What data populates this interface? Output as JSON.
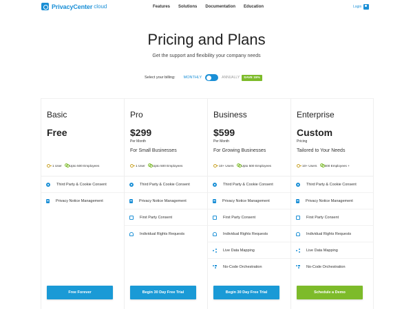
{
  "header": {
    "logo_text": "PrivacyCenter",
    "logo_sub": "cloud",
    "nav": [
      "Features",
      "Solutions",
      "Documentation",
      "Education"
    ],
    "login": "Login"
  },
  "hero": {
    "title": "Pricing and Plans",
    "subtitle": "Get the support and flexibility your company needs"
  },
  "billing": {
    "label": "Select your billing:",
    "monthly": "MONTHLY",
    "annually": "ANNUALLY",
    "save_badge": "SAVE 15%"
  },
  "colors": {
    "brand_blue": "#1a8fd6",
    "cta_blue": "#1a9ad6",
    "accent_green": "#7dbb2a"
  },
  "plans": [
    {
      "name": "Basic",
      "price": "Free",
      "period": "",
      "tagline": "",
      "users": "1 User",
      "employees": "Upto 500 Employees",
      "features": [
        {
          "icon": "cookie-icon",
          "label": "Third Party & Cookie Consent"
        },
        {
          "icon": "notice-icon",
          "label": "Privacy Notice Management"
        }
      ],
      "cta": "Free Forever"
    },
    {
      "name": "Pro",
      "price": "$299",
      "period": "Per Month",
      "tagline": "For Small Businesses",
      "users": "1 User",
      "employees": "Upto 500 Employees",
      "features": [
        {
          "icon": "cookie-icon",
          "label": "Third Party & Cookie Consent"
        },
        {
          "icon": "notice-icon",
          "label": "Privacy Notice Management"
        },
        {
          "icon": "first-party-icon",
          "label": "First Party Consent"
        },
        {
          "icon": "rights-icon",
          "label": "Individual Rights Requests"
        }
      ],
      "cta": "Begin 30 Day Free Trial"
    },
    {
      "name": "Business",
      "price": "$599",
      "period": "Per Month",
      "tagline": "For Growing Businesses",
      "users": "10+ Users",
      "employees": "Upto 500 Employees",
      "features": [
        {
          "icon": "cookie-icon",
          "label": "Third Party & Cookie Consent"
        },
        {
          "icon": "notice-icon",
          "label": "Privacy Notice Management"
        },
        {
          "icon": "first-party-icon",
          "label": "First Party Consent"
        },
        {
          "icon": "rights-icon",
          "label": "Individual Rights Requests"
        },
        {
          "icon": "mapping-icon",
          "label": "Live Data Mapping"
        },
        {
          "icon": "orchestration-icon",
          "label": "No-Code Orchestration"
        }
      ],
      "cta": "Begin 30 Day Free Trial"
    },
    {
      "name": "Enterprise",
      "price": "Custom",
      "period": "Pricing",
      "tagline": "Tailored to Your Needs",
      "users": "10+ Users",
      "employees": "600 Employees +",
      "features": [
        {
          "icon": "cookie-icon",
          "label": "Third Party & Cookie Consent"
        },
        {
          "icon": "notice-icon",
          "label": "Privacy Notice Management"
        },
        {
          "icon": "first-party-icon",
          "label": "First Party Consent"
        },
        {
          "icon": "rights-icon",
          "label": "Individual Rights Requests"
        },
        {
          "icon": "mapping-icon",
          "label": "Live Data Mapping"
        },
        {
          "icon": "orchestration-icon",
          "label": "No-Code Orchestration"
        }
      ],
      "cta": "Schedule a Demo"
    }
  ]
}
